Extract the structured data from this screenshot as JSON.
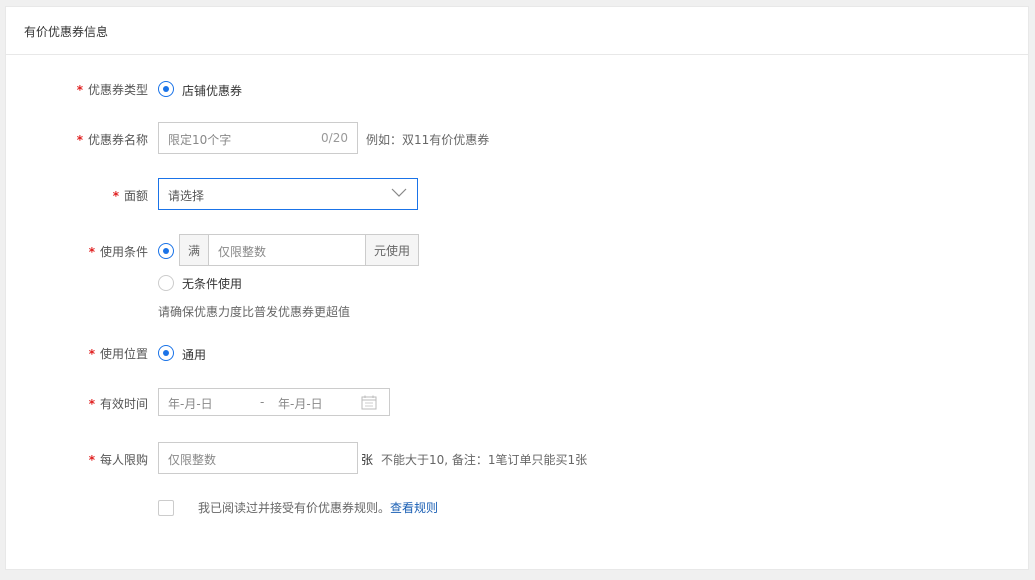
{
  "header": {
    "title": "有价优惠券信息"
  },
  "form": {
    "coupon_type": {
      "label": "优惠券类型",
      "option": "店铺优惠券"
    },
    "coupon_name": {
      "label": "优惠券名称",
      "placeholder": "限定10个字",
      "counter": "0/20",
      "hint": "例如：双11有价优惠券"
    },
    "denomination": {
      "label": "面额",
      "placeholder": "请选择"
    },
    "use_condition": {
      "label": "使用条件",
      "prefix": "满",
      "placeholder": "仅限整数",
      "suffix": "元使用",
      "option_unconditional": "无条件使用",
      "hint": "请确保优惠力度比普发优惠券更超值"
    },
    "use_location": {
      "label": "使用位置",
      "option": "通用"
    },
    "valid_time": {
      "label": "有效时间",
      "start_placeholder": "年-月-日",
      "separator": "-",
      "end_placeholder": "年-月-日"
    },
    "per_person_limit": {
      "label": "每人限购",
      "placeholder": "仅限整数",
      "unit": "张",
      "hint": "不能大于10, 备注：1笔订单只能买1张"
    },
    "agreement": {
      "text": "我已阅读过并接受有价优惠券规则。",
      "link": "查看规则"
    }
  },
  "colors": {
    "accent": "#1a73e8",
    "required": "#e02020",
    "link": "#1a5fb4"
  }
}
